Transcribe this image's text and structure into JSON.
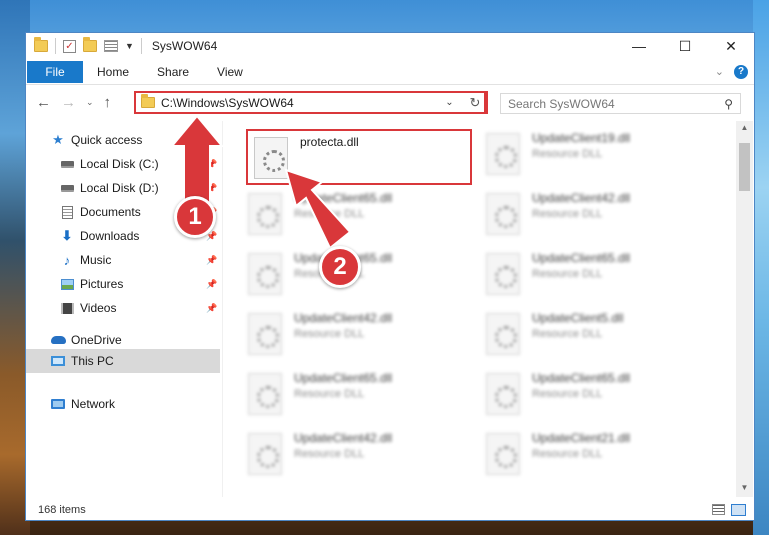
{
  "window": {
    "title": "SysWOW64",
    "minimize_glyph": "—",
    "maximize_glyph": "☐",
    "close_glyph": "✕"
  },
  "ribbon": {
    "tabs": [
      "File",
      "Home",
      "Share",
      "View"
    ],
    "help_glyph": "?"
  },
  "address": {
    "path": "C:\\Windows\\SysWOW64",
    "search_placeholder": "Search SysWOW64"
  },
  "navpane": {
    "items": [
      {
        "label": "Quick access",
        "icon": "star-icon"
      },
      {
        "label": "Local Disk (C:)",
        "icon": "drive-icon",
        "pinned": true
      },
      {
        "label": "Local Disk (D:)",
        "icon": "drive-icon",
        "pinned": true
      },
      {
        "label": "Documents",
        "icon": "documents-icon",
        "pinned": true
      },
      {
        "label": "Downloads",
        "icon": "download-icon",
        "pinned": true
      },
      {
        "label": "Music",
        "icon": "music-icon",
        "pinned": true
      },
      {
        "label": "Pictures",
        "icon": "pictures-icon",
        "pinned": true
      },
      {
        "label": "Videos",
        "icon": "videos-icon",
        "pinned": true
      },
      {
        "label": "OneDrive",
        "icon": "onedrive-icon"
      },
      {
        "label": "This PC",
        "icon": "this-pc-icon",
        "selected": true
      },
      {
        "label": "Network",
        "icon": "network-icon"
      }
    ]
  },
  "files": [
    {
      "name": "protecta.dll",
      "type": ""
    },
    {
      "name": "UpdateClient19.dll",
      "type": "Resource DLL"
    },
    {
      "name": "UpdateClient65.dll",
      "type": "Resource DLL"
    },
    {
      "name": "UpdateClient42.dll",
      "type": "Resource DLL"
    },
    {
      "name": "UpdateClient65.dll",
      "type": "Resource DLL"
    },
    {
      "name": "UpdateClient65.dll",
      "type": "Resource DLL"
    },
    {
      "name": "UpdateClient42.dll",
      "type": "Resource DLL"
    },
    {
      "name": "UpdateClient5.dll",
      "type": "Resource DLL"
    },
    {
      "name": "UpdateClient65.dll",
      "type": "Resource DLL"
    },
    {
      "name": "UpdateClient65.dll",
      "type": "Resource DLL"
    },
    {
      "name": "UpdateClient42.dll",
      "type": "Resource DLL"
    },
    {
      "name": "UpdateClient21.dll",
      "type": "Resource DLL"
    }
  ],
  "status": {
    "item_count": "168 items"
  },
  "callouts": {
    "step1": "1",
    "step2": "2",
    "color": "#d9373a"
  }
}
